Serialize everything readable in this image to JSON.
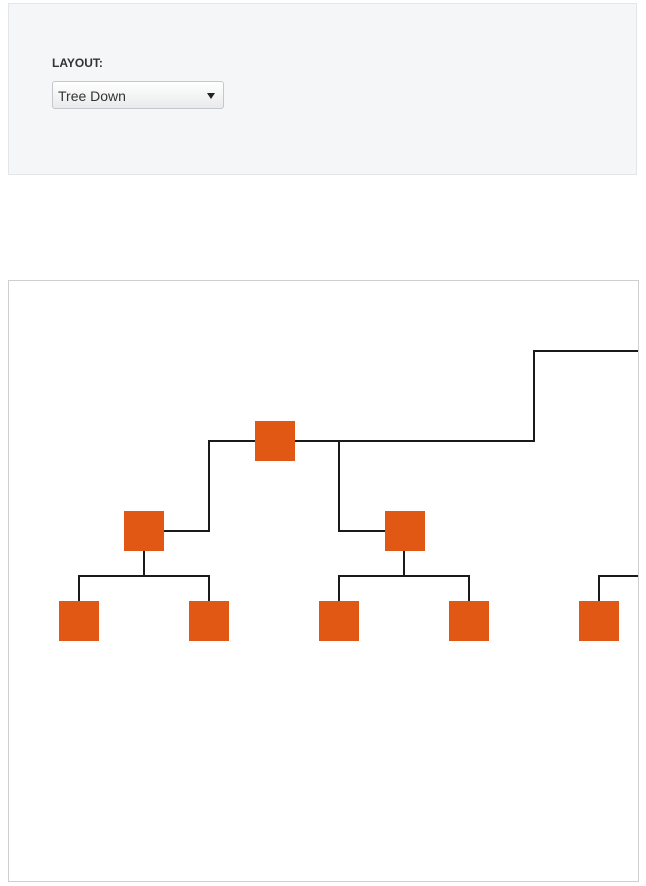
{
  "config": {
    "layout_label": "LAYOUT:",
    "layout_value": "Tree Down",
    "layout_options": [
      "Tree Down"
    ]
  },
  "diagram": {
    "node_color": "#e15815",
    "link_color": "#1a1a1a",
    "nodes": [
      {
        "id": "root"
      },
      {
        "id": "left-child",
        "parent": "root"
      },
      {
        "id": "right-child",
        "parent": "root"
      },
      {
        "id": "left-left-leaf",
        "parent": "left-child"
      },
      {
        "id": "left-right-leaf",
        "parent": "left-child"
      },
      {
        "id": "right-left-leaf",
        "parent": "right-child"
      },
      {
        "id": "right-right-leaf",
        "parent": "right-child"
      },
      {
        "id": "offscreen-leaf"
      }
    ]
  }
}
